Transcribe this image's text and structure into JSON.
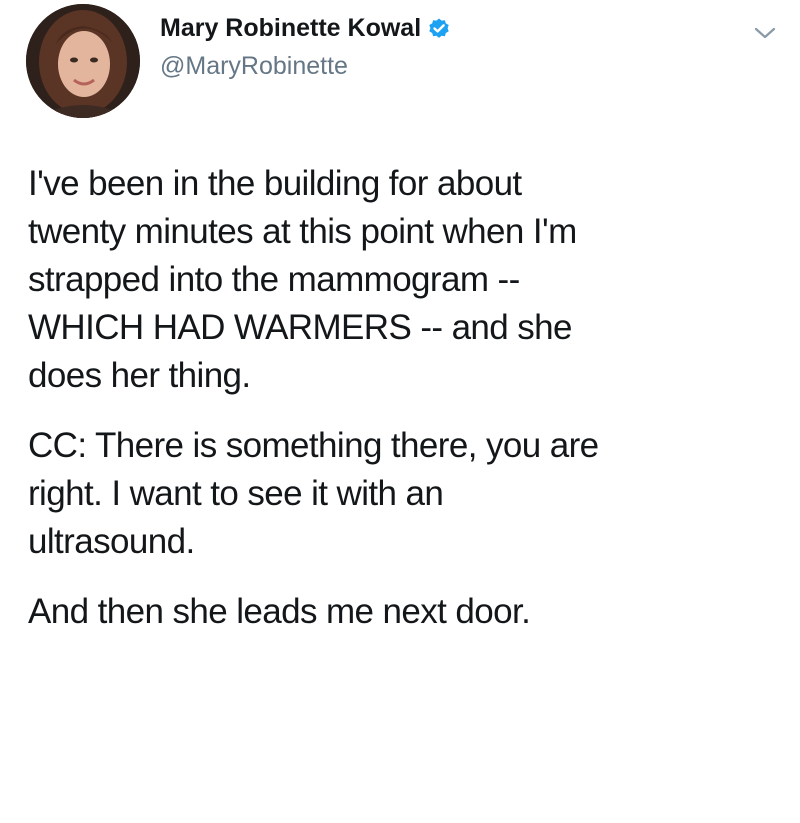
{
  "tweet": {
    "author": {
      "display_name": "Mary Robinette Kowal",
      "handle": "@MaryRobinette",
      "verified": true
    },
    "icons": {
      "verified": "verified-badge-icon",
      "menu": "chevron-down-icon"
    },
    "colors": {
      "verified_blue": "#1da1f2",
      "handle_gray": "#657786",
      "text": "#14171a"
    },
    "paragraphs": [
      {
        "lines": [
          "I've been in the building for about",
          "twenty minutes at this point when I'm",
          "strapped into the mammogram --",
          "WHICH HAD WARMERS -- and she",
          "does her thing."
        ]
      },
      {
        "lines": [
          "CC: There is something there, you are",
          "right. I want to see it with an",
          "ultrasound."
        ]
      },
      {
        "lines": [
          "And then she leads me next door."
        ]
      }
    ]
  }
}
